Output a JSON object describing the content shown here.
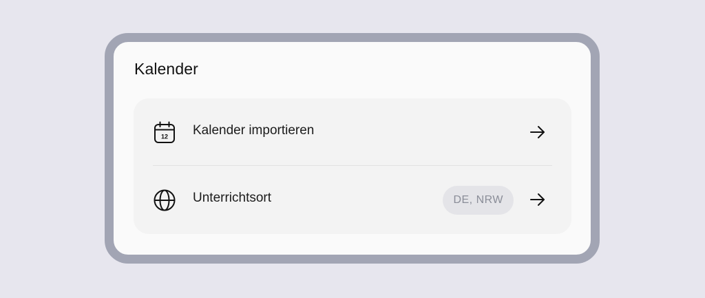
{
  "card": {
    "title": "Kalender"
  },
  "settings": {
    "items": [
      {
        "label": "Kalender importieren",
        "icon": "calendar-icon",
        "icon_text": "12"
      },
      {
        "label": "Unterrichtsort",
        "icon": "globe-icon",
        "value": "DE, NRW"
      }
    ]
  },
  "colors": {
    "background": "#e7e6ee",
    "frame_border": "#a2a5b4",
    "card": "#fafafa",
    "group": "#f3f3f3",
    "badge_bg": "#e4e4e8",
    "badge_text": "#8a8d98"
  }
}
